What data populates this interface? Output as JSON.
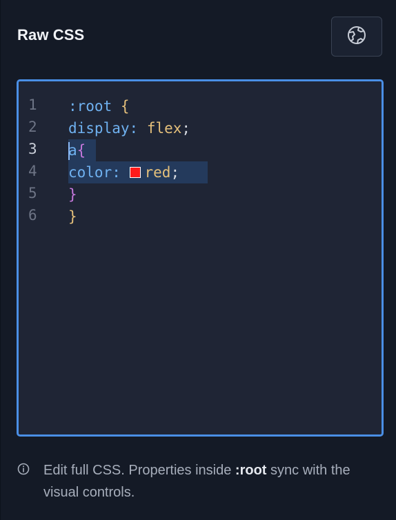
{
  "header": {
    "title": "Raw CSS",
    "action_icon": "globe-network-icon"
  },
  "editor": {
    "line_numbers": [
      "1",
      "2",
      "3",
      "4",
      "5",
      "6"
    ],
    "active_line": "3",
    "lines": {
      "l1_selector": ":root",
      "l1_brace": " {",
      "l2_prop": "display",
      "l2_colon": ": ",
      "l2_value": "flex",
      "l2_semi": ";",
      "l3_selector": "a",
      "l3_brace": "{",
      "l4_prop": "color",
      "l4_colon": ": ",
      "l4_value": "red",
      "l4_semi": ";",
      "l5_brace": "}",
      "l6_brace": "}"
    },
    "color_swatch": "#ff1a1a"
  },
  "footer": {
    "icon": "info-circle-icon",
    "text_before": "Edit full CSS. Properties inside ",
    "text_bold": ":root",
    "text_after": " sync with the visual controls."
  }
}
